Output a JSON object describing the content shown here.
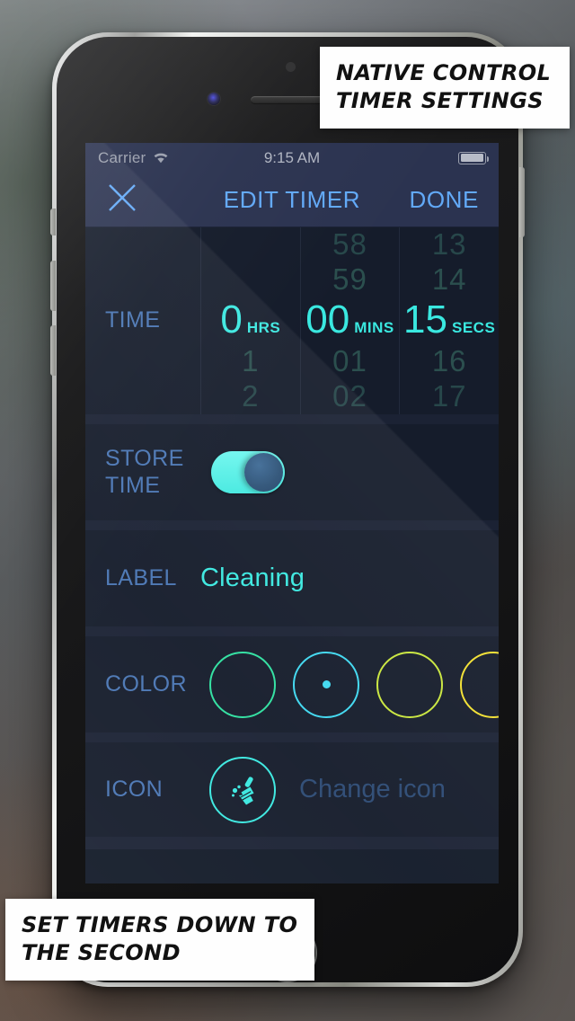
{
  "captions": {
    "top": [
      "NATIVE CONTROL",
      "TIMER SETTINGS"
    ],
    "bottom": [
      "SET TIMERS DOWN TO",
      "THE SECOND"
    ]
  },
  "status_bar": {
    "carrier": "Carrier",
    "wifi_icon": "wifi-icon",
    "time": "9:15 AM",
    "battery_icon": "battery-icon"
  },
  "nav_bar": {
    "close_icon": "close-icon",
    "title": "EDIT TIMER",
    "done_label": "DONE"
  },
  "rows": {
    "time": {
      "label": "TIME",
      "columns": [
        {
          "name": "hours",
          "unit": "HRS",
          "above": [
            "",
            ""
          ],
          "selected": "0",
          "below": [
            "1",
            "2"
          ]
        },
        {
          "name": "minutes",
          "unit": "MINS",
          "above": [
            "58",
            "59"
          ],
          "selected": "00",
          "below": [
            "01",
            "02"
          ]
        },
        {
          "name": "seconds",
          "unit": "SECS",
          "above": [
            "13",
            "14"
          ],
          "selected": "15",
          "below": [
            "16",
            "17"
          ]
        }
      ]
    },
    "store_time": {
      "label": "STORE TIME",
      "label_lines": [
        "STORE",
        "TIME"
      ],
      "toggle_state": "on"
    },
    "label": {
      "label": "LABEL",
      "value": "Cleaning"
    },
    "color": {
      "label": "COLOR",
      "swatches": [
        {
          "color": "#2fe0a0",
          "selected": false
        },
        {
          "color": "#3fd8f0",
          "selected": true
        },
        {
          "color": "#c9e63c",
          "selected": false
        },
        {
          "color": "#f2e030",
          "selected": false
        }
      ]
    },
    "icon": {
      "label": "ICON",
      "icon_name": "broom-icon",
      "change_text": "Change icon"
    }
  },
  "theme": {
    "accent_cyan": "#3ae8e0",
    "label_blue": "#4a76b4",
    "nav_blue": "#62a9f7",
    "nav_bar_bg": "#2b3350",
    "screen_bg": "#0f1622"
  }
}
